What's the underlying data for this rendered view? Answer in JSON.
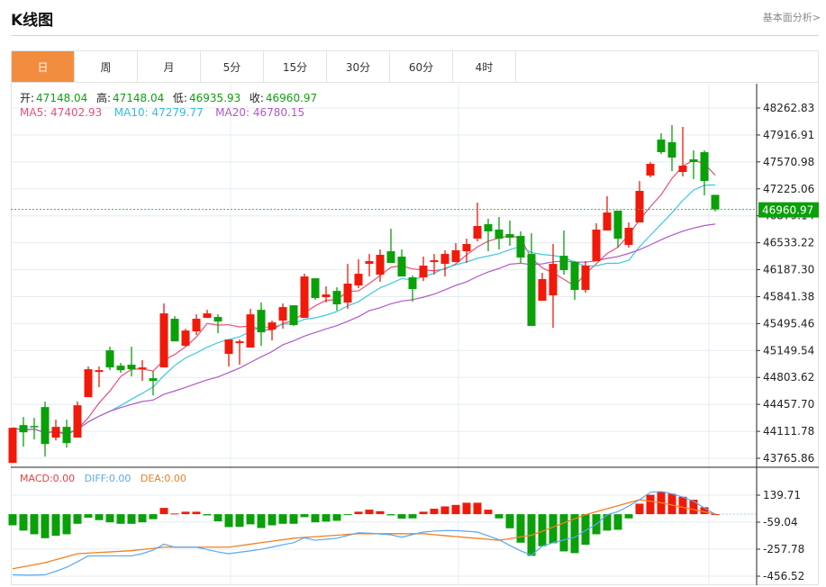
{
  "header": {
    "title": "K线图",
    "link": "基本面分析>"
  },
  "tabs": [
    {
      "label": "日",
      "active": true
    },
    {
      "label": "周"
    },
    {
      "label": "月"
    },
    {
      "label": "5分"
    },
    {
      "label": "15分"
    },
    {
      "label": "30分"
    },
    {
      "label": "60分"
    },
    {
      "label": "4时"
    }
  ],
  "ohlc": {
    "open_label": "开:",
    "open": "47148.04",
    "high_label": "高:",
    "high": "47148.04",
    "low_label": "低:",
    "low": "46935.93",
    "close_label": "收:",
    "close": "46960.97"
  },
  "ma": {
    "ma5": "MA5: 47402.93",
    "ma10": "MA10: 47279.77",
    "ma20": "MA20: 46780.15"
  },
  "macd_info": {
    "macd": "MACD:0.00",
    "diff": "DIFF:0.00",
    "dea": "DEA:0.00"
  },
  "colors": {
    "up": "#f01a0a",
    "down": "#0aa00a",
    "ma5": "#e8507a",
    "ma10": "#3cc8e0",
    "ma20": "#b058c8",
    "diff": "#5aa8f0",
    "dea": "#f08020",
    "accent": "#f28d40"
  },
  "chart_data": {
    "type": "candlestick",
    "price_ticks": [
      "48262.83",
      "47916.91",
      "47570.98",
      "47225.06",
      "46879.14",
      "46533.22",
      "46187.30",
      "45841.38",
      "45495.46",
      "45149.54",
      "44803.62",
      "44457.70",
      "44111.78",
      "43765.86"
    ],
    "ylim": [
      43765.86,
      48262.83
    ],
    "last_price": "46960.97",
    "candles_ohlc": [
      [
        43706,
        44157,
        43706,
        44157
      ],
      [
        44192,
        44296,
        43914,
        44099
      ],
      [
        44180,
        44284,
        44007,
        44169
      ],
      [
        44423,
        44493,
        43787,
        43949
      ],
      [
        44031,
        44261,
        43995,
        44169
      ],
      [
        44169,
        44261,
        43903,
        43961
      ],
      [
        44031,
        44493,
        44031,
        44446
      ],
      [
        44550,
        44944,
        44550,
        44909
      ],
      [
        44874,
        44944,
        44678,
        44897
      ],
      [
        45152,
        45198,
        44897,
        44932
      ],
      [
        44955,
        44990,
        44863,
        44897
      ],
      [
        44967,
        45198,
        44816,
        44909
      ],
      [
        44909,
        45025,
        44759,
        44932
      ],
      [
        44793,
        44886,
        44573,
        44759
      ],
      [
        44932,
        45753,
        44932,
        45626
      ],
      [
        45557,
        45591,
        45267,
        45267
      ],
      [
        45210,
        45429,
        45198,
        45406
      ],
      [
        45395,
        45614,
        45348,
        45557
      ],
      [
        45568,
        45672,
        45568,
        45626
      ],
      [
        45580,
        45614,
        45372,
        45522
      ],
      [
        45106,
        45291,
        44944,
        45291
      ],
      [
        45244,
        45291,
        44967,
        45267
      ],
      [
        45187,
        45684,
        45187,
        45614
      ],
      [
        45672,
        45765,
        45210,
        45383
      ],
      [
        45418,
        45533,
        45279,
        45510
      ],
      [
        45533,
        45753,
        45429,
        45707
      ],
      [
        45730,
        45730,
        45464,
        45476
      ],
      [
        45568,
        46135,
        45568,
        46100
      ],
      [
        46077,
        46077,
        45800,
        45823
      ],
      [
        45834,
        45973,
        45765,
        45869
      ],
      [
        45915,
        45961,
        45661,
        45742
      ],
      [
        45765,
        46262,
        45684,
        46008
      ],
      [
        45985,
        46320,
        45950,
        46135
      ],
      [
        46262,
        46389,
        46100,
        46297
      ],
      [
        46123,
        46447,
        46031,
        46378
      ],
      [
        46424,
        46713,
        46274,
        46274
      ],
      [
        46355,
        46447,
        46100,
        46100
      ],
      [
        46089,
        46112,
        45776,
        45938
      ],
      [
        46089,
        46355,
        46042,
        46239
      ],
      [
        46285,
        46389,
        46123,
        46308
      ],
      [
        46262,
        46436,
        46100,
        46389
      ],
      [
        46285,
        46528,
        46285,
        46436
      ],
      [
        46424,
        46586,
        46274,
        46517
      ],
      [
        46586,
        47049,
        46551,
        46748
      ],
      [
        46771,
        46841,
        46424,
        46679
      ],
      [
        46702,
        46864,
        46447,
        46586
      ],
      [
        46644,
        46817,
        46494,
        46598
      ],
      [
        46621,
        46679,
        46274,
        46343
      ],
      [
        46389,
        46655,
        45464,
        45464
      ],
      [
        45788,
        46147,
        45788,
        46066
      ],
      [
        45857,
        46517,
        45441,
        46262
      ],
      [
        46366,
        46690,
        46123,
        46181
      ],
      [
        46285,
        46297,
        45800,
        45927
      ],
      [
        45927,
        46297,
        45892,
        46239
      ],
      [
        46297,
        46783,
        46297,
        46702
      ],
      [
        46690,
        47130,
        46690,
        46921
      ],
      [
        46945,
        46945,
        46470,
        46586
      ],
      [
        46505,
        46794,
        46470,
        46725
      ],
      [
        46794,
        47326,
        46794,
        47199
      ],
      [
        47396,
        47569,
        47373,
        47546
      ],
      [
        47858,
        47939,
        47673,
        47696
      ],
      [
        47824,
        48043,
        47454,
        47627
      ],
      [
        47442,
        48020,
        47384,
        47523
      ],
      [
        47604,
        47720,
        47349,
        47569
      ],
      [
        47696,
        47720,
        47141,
        47326
      ],
      [
        47148.04,
        47148.04,
        46935.93,
        46960.97
      ]
    ],
    "macd_ticks": [
      "139.71",
      "-59.04",
      "-257.78",
      "-456.52"
    ],
    "macd_ylim": [
      -456.52,
      139.71
    ],
    "macd_hist": [
      -82,
      -121,
      -148,
      -177,
      -159,
      -148,
      -71,
      -26,
      -44,
      -60,
      -71,
      -71,
      -60,
      -37,
      46,
      5,
      18,
      18,
      -9,
      -53,
      -95,
      -93,
      -75,
      -102,
      -82,
      -71,
      -71,
      -22,
      -60,
      -55,
      -49,
      -4,
      18,
      33,
      22,
      -9,
      -33,
      -31,
      18,
      40,
      57,
      68,
      84,
      84,
      33,
      -31,
      -104,
      -210,
      -307,
      -236,
      -214,
      -274,
      -287,
      -225,
      -148,
      -121,
      -115,
      -31,
      77,
      143,
      166,
      150,
      128,
      106,
      51,
      0
    ],
    "diff": [
      -446,
      -448,
      -448,
      -446,
      -420,
      -391,
      -350,
      -307,
      -307,
      -307,
      -307,
      -307,
      -290,
      -265,
      -221,
      -243,
      -243,
      -243,
      -260,
      -278,
      -291,
      -280,
      -270,
      -258,
      -242,
      -225,
      -210,
      -174,
      -192,
      -185,
      -177,
      -157,
      -137,
      -140,
      -146,
      -152,
      -170,
      -150,
      -132,
      -125,
      -121,
      -121,
      -126,
      -132,
      -160,
      -188,
      -230,
      -270,
      -302,
      -236,
      -210,
      -190,
      -170,
      -120,
      -75,
      -4,
      18,
      60,
      106,
      161,
      166,
      150,
      125,
      95,
      45,
      0
    ],
    "dea": [
      -402,
      -387,
      -372,
      -357,
      -335,
      -313,
      -291,
      -287,
      -282,
      -278,
      -273,
      -269,
      -260,
      -252,
      -243,
      -243,
      -243,
      -243,
      -243,
      -243,
      -243,
      -232,
      -221,
      -210,
      -199,
      -188,
      -177,
      -171,
      -166,
      -160,
      -155,
      -149,
      -144,
      -144,
      -144,
      -144,
      -144,
      -144,
      -144,
      -151,
      -158,
      -165,
      -172,
      -178,
      -185,
      -192,
      -180,
      -167,
      -155,
      -125,
      -95,
      -64,
      -34,
      -4,
      18,
      40,
      62,
      84,
      106,
      95,
      84,
      67,
      50,
      34,
      17,
      0
    ]
  }
}
